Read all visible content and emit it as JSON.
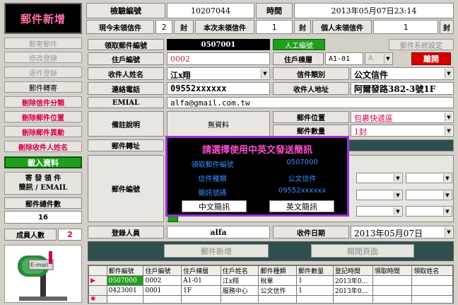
{
  "app": {
    "title": "郵件新增"
  },
  "header": {
    "check_no_label": "檢驗編號",
    "check_no_value": "10207044",
    "time_label": "時間",
    "time_value": "2013年05月07日23:14",
    "current_unreceived_label": "現今未領信件",
    "current_unreceived_value": "2",
    "unit_1": "封",
    "this_unreceived_label": "本次未領信件",
    "this_unreceived_value": "1",
    "unit_2": "封",
    "personal_unreceived_label": "個人未領信件",
    "personal_unreceived_value": "1",
    "unit_3": "封"
  },
  "sidebar": {
    "items": [
      {
        "label": "郵寄郵件"
      },
      {
        "label": "修改登錄"
      },
      {
        "label": "退件登錄"
      },
      {
        "label": "郵件轉寄"
      },
      {
        "label": "刪除信件分類"
      },
      {
        "label": "刪除郵件位置"
      },
      {
        "label": "刪除郵件異動"
      },
      {
        "label": "刪除收件人姓名"
      }
    ],
    "load_button": "載入資料",
    "sms_label_1": "寄 發 領 件",
    "sms_label_2": "簡訊 / EMAIL",
    "total_count_label": "郵件總件數",
    "total_count_value": "16",
    "member_count_label": "成員人數",
    "member_count_value": "2",
    "logo_text": "E-mail"
  },
  "form": {
    "receive_no_label": "領取郵件編號",
    "receive_no_value": "0507001",
    "manual_button": "人工編號",
    "settings_button": "郵件系統設定",
    "household_no_label": "住戶編號",
    "household_no_value": "0002",
    "building_label": "住戶棟層",
    "building_value": "A1-01",
    "building_letter": "A",
    "exit_button": "離開",
    "recipient_label": "收件人姓名",
    "recipient_value": "江x翔",
    "type_label": "信件類別",
    "type_value": "公文信件",
    "phone_label": "連絡電話",
    "phone_value": "09552xxxxxx",
    "address_label": "收件人地址",
    "address_value": "阿爾發路382-3號1F",
    "email_label": "EMIAL",
    "email_value": "alfa@gmail.com.tw",
    "note_label": "備註說明",
    "note_value": "無資料",
    "position_label": "郵件位置",
    "position_value": "包裹快遞區",
    "quantity_label": "郵件數量",
    "quantity_value": "1封",
    "forward_label": "郵件轉址",
    "mail_no_label": "郵件編號",
    "registrar_label": "登錄人員",
    "registrar_value": "alfa",
    "receive_date_label": "收件日期",
    "receive_date_value": "2013年05月07日",
    "add_button": "郵件新增",
    "close_button": "關閉頁面"
  },
  "modal": {
    "title": "請選擇使用中英文發送簡訊",
    "rows": [
      {
        "label": "領取郵件編號",
        "value": "0507000"
      },
      {
        "label": "信件種類",
        "value": "公文信件"
      },
      {
        "label": "簡訊號碼",
        "value": "09552xxxxxx"
      }
    ],
    "chinese_button": "中文簡訊",
    "english_button": "英文簡訊"
  },
  "table": {
    "headers": [
      "郵件編號",
      "住戶編號",
      "住戶棟層",
      "住戶姓名",
      "郵件種類",
      "郵件數量",
      "登記時間",
      "領取時間",
      "領取姓名"
    ],
    "rows": [
      [
        "0507000",
        "0002",
        "A1-01",
        "江x翔",
        "稅單",
        "1",
        "2013年0…",
        "",
        ""
      ],
      [
        "0423001",
        "0001",
        "1F",
        "服務中心",
        "公文信件",
        "1",
        "2013年0…",
        "",
        ""
      ],
      [
        "",
        "",
        "",
        "",
        "",
        "",
        "",
        "",
        ""
      ]
    ]
  },
  "colors": {
    "title_bg": "#000000",
    "title_text": "#ff6ea8",
    "header_bg": "#2f4f4f",
    "accent_green": "#1ea01e",
    "modal_bg": "#000000",
    "modal_border": "#9b30d9",
    "modal_title": "#ff4bd0",
    "modal_text": "#3a8cff",
    "warning_red": "#d8004a"
  }
}
